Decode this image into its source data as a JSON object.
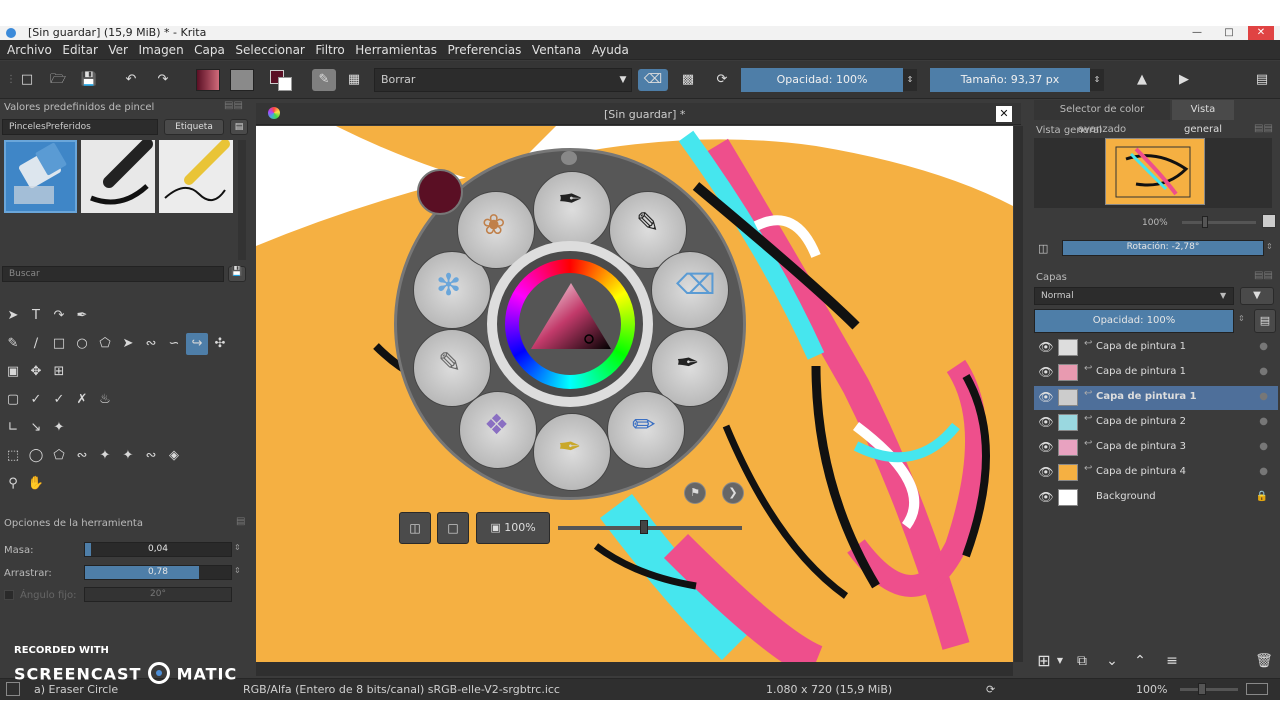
{
  "window": {
    "title": "[Sin guardar]  (15,9 MiB)  * - Krita"
  },
  "menu": [
    "Archivo",
    "Editar",
    "Ver",
    "Imagen",
    "Capa",
    "Seleccionar",
    "Filtro",
    "Herramientas",
    "Preferencias",
    "Ventana",
    "Ayuda"
  ],
  "toolbar": {
    "blend_mode": "Borrar",
    "opacity": "Opacidad: 100%",
    "size": "Tamaño: 93,37 px"
  },
  "brush_presets": {
    "title": "Valores predefinidos de pincel",
    "tag_select": "PincelesPreferidos",
    "tag_button": "Etiqueta",
    "search_placeholder": "Buscar"
  },
  "tool_options": {
    "title": "Opciones de la herramienta",
    "mass_label": "Masa:",
    "mass_value": "0,04",
    "mass_fraction": 0.04,
    "drag_label": "Arrastrar:",
    "drag_value": "0,78",
    "drag_fraction": 0.78,
    "angle_label": "Ángulo fijo:",
    "angle_value": "20°"
  },
  "canvas": {
    "tab_title": "[Sin guardar]  *"
  },
  "popup_palette": {
    "zoom": "100%"
  },
  "right_tabs": [
    "Selector de color avanzado",
    "Vista general"
  ],
  "overview": {
    "title": "Vista general",
    "zoom": "100%",
    "rotation": "Rotación: -2,78°"
  },
  "layers": {
    "title": "Capas",
    "blend_mode": "Normal",
    "opacity": "Opacidad:  100%",
    "items": [
      {
        "name": "Capa de pintura 1",
        "selected": false,
        "locked": false
      },
      {
        "name": "Capa de pintura 1",
        "selected": false,
        "locked": false
      },
      {
        "name": "Capa de pintura 1",
        "selected": true,
        "locked": false
      },
      {
        "name": "Capa de pintura 2",
        "selected": false,
        "locked": false
      },
      {
        "name": "Capa de pintura 3",
        "selected": false,
        "locked": false
      },
      {
        "name": "Capa de pintura 4",
        "selected": false,
        "locked": false
      },
      {
        "name": "Background",
        "selected": false,
        "locked": true
      }
    ]
  },
  "status": {
    "brush": "a) Eraser Circle",
    "color_space": "RGB/Alfa (Entero de 8 bits/canal)  sRGB-elle-V2-srgbtrc.icc",
    "dimensions": "1.080 x 720 (15,9 MiB)",
    "zoom": "100%"
  },
  "watermark": {
    "line1": "RECORDED WITH",
    "line2a": "SCREENCAST",
    "line2b": "MATIC"
  },
  "colors": {
    "accent": "#4e7ea8",
    "canvas_orange": "#f5b042",
    "pink": "#ee4f8c",
    "cyan": "#46e6ee",
    "fg_color": "#5a0f24"
  }
}
